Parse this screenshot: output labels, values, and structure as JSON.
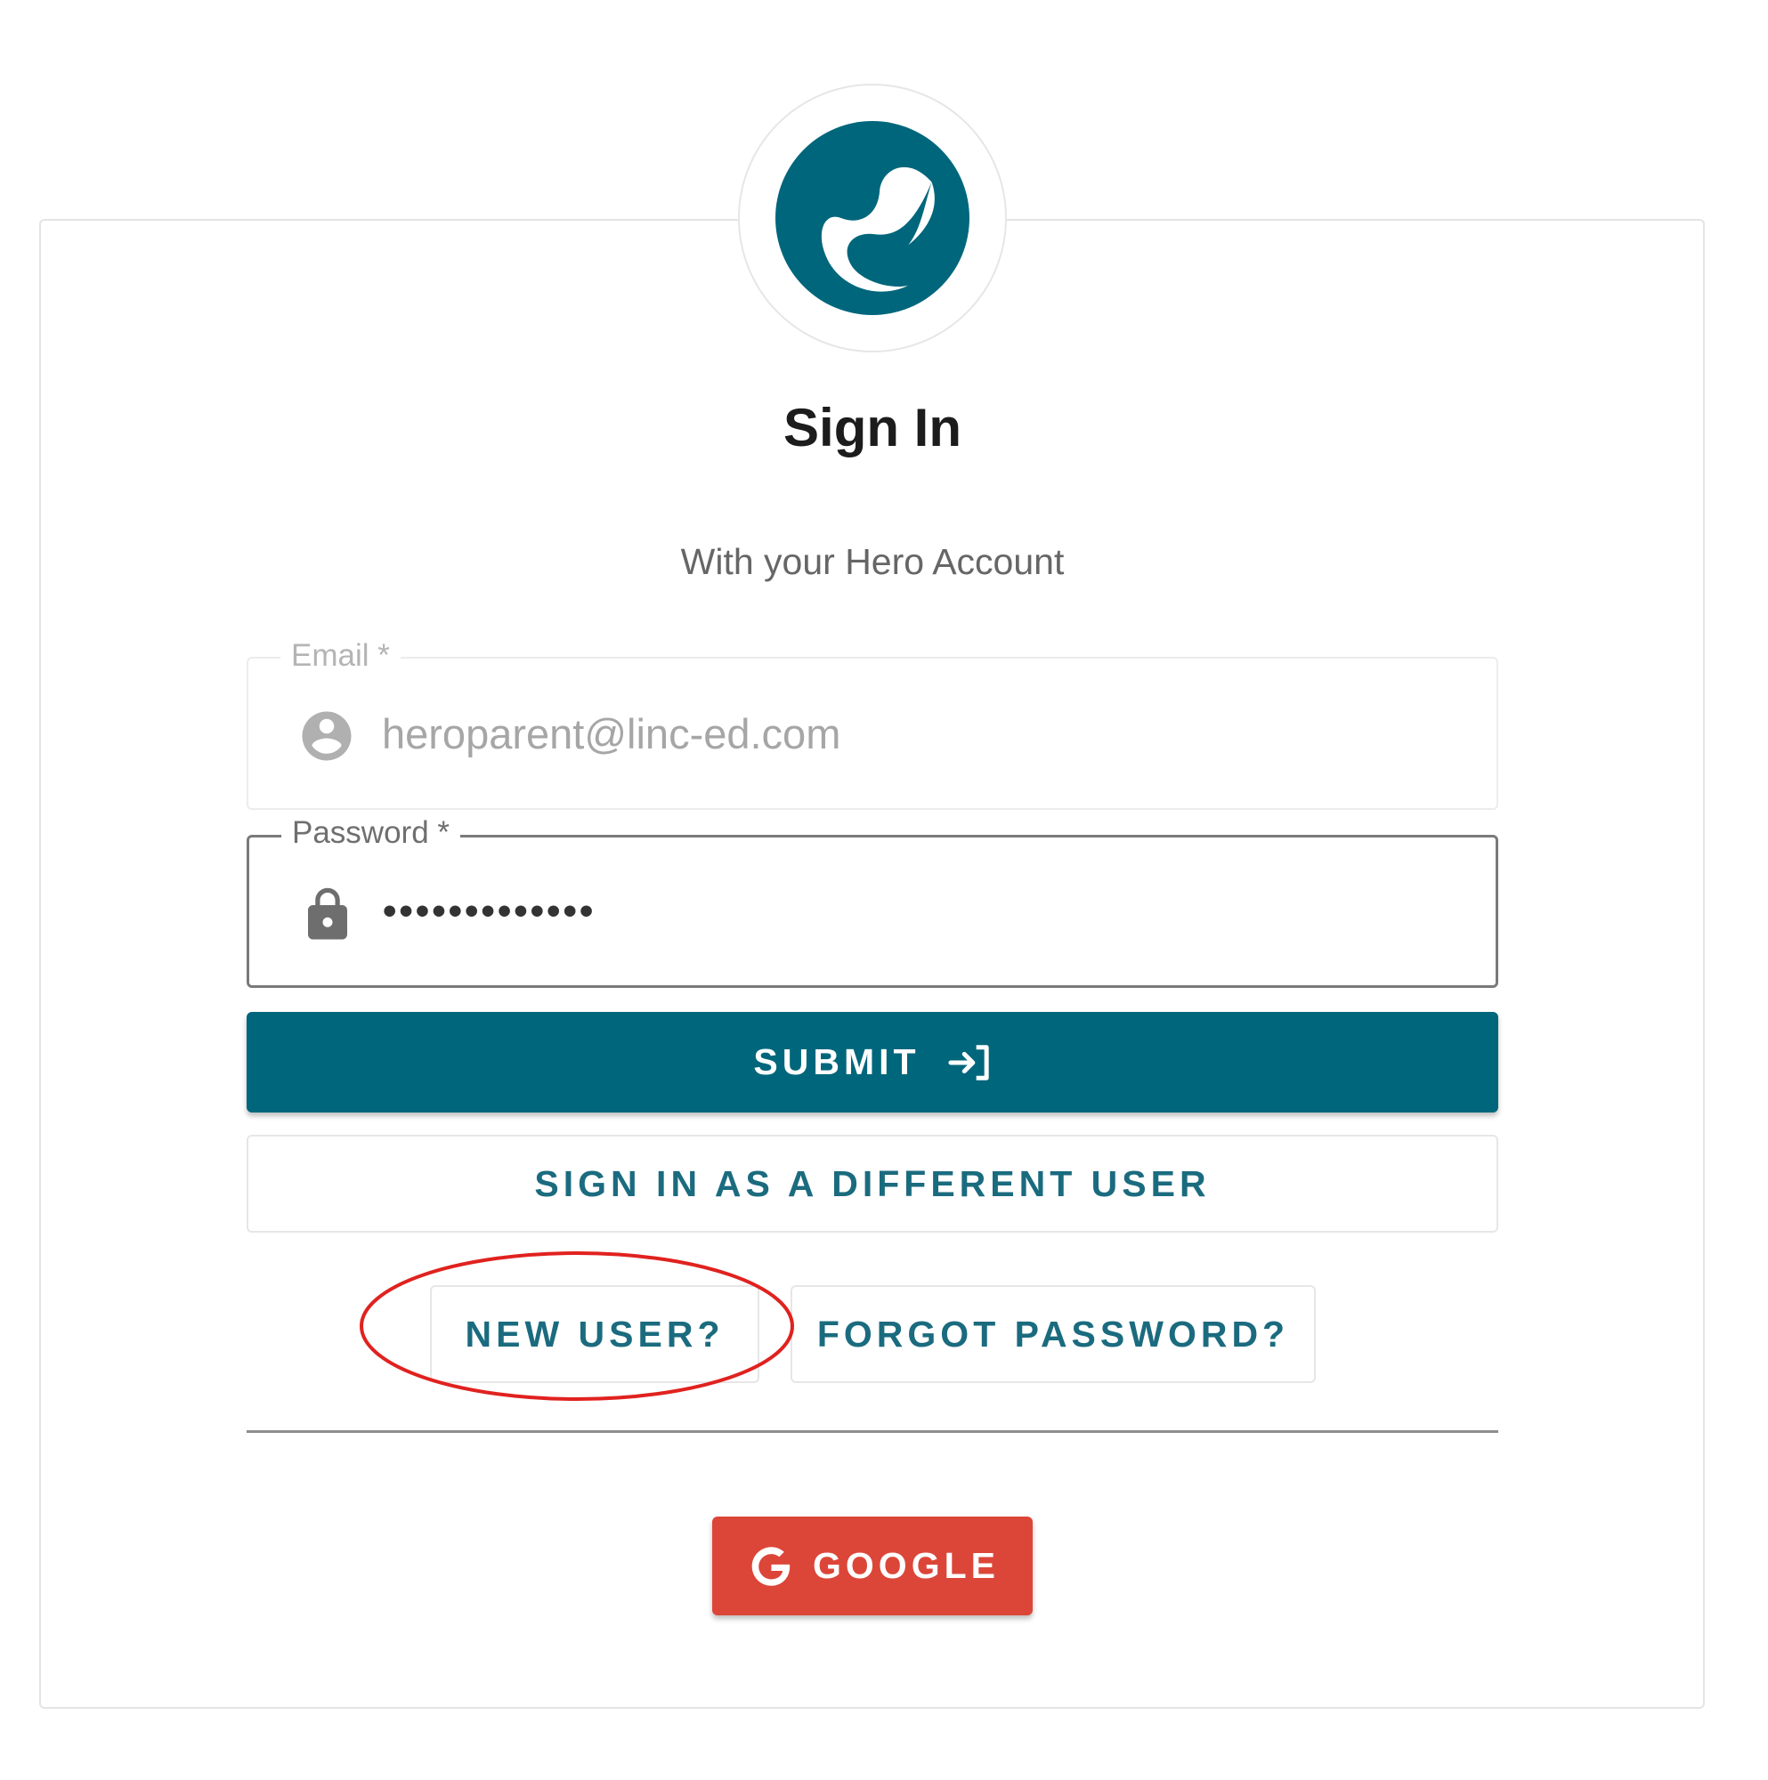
{
  "brand": {
    "accent": "#00667c",
    "google": "#dc4638"
  },
  "header": {
    "title": "Sign In",
    "subtitle": "With your Hero Account"
  },
  "form": {
    "email": {
      "label": "Email *",
      "value": "heroparent@linc-ed.com",
      "icon": "account-circle-icon"
    },
    "password": {
      "label": "Password *",
      "value": "•••••••••••••",
      "icon": "lock-icon"
    }
  },
  "actions": {
    "submit_label": "SUBMIT",
    "submit_icon": "login-arrow-icon",
    "different_user_label": "SIGN IN AS A DIFFERENT USER",
    "new_user_label": "NEW USER?",
    "forgot_password_label": "FORGOT PASSWORD?",
    "google_label": "GOOGLE",
    "google_icon": "google-g-icon"
  },
  "annotation": {
    "type": "red-ellipse-highlight",
    "target": "new-user-button",
    "color": "#e0221f"
  }
}
